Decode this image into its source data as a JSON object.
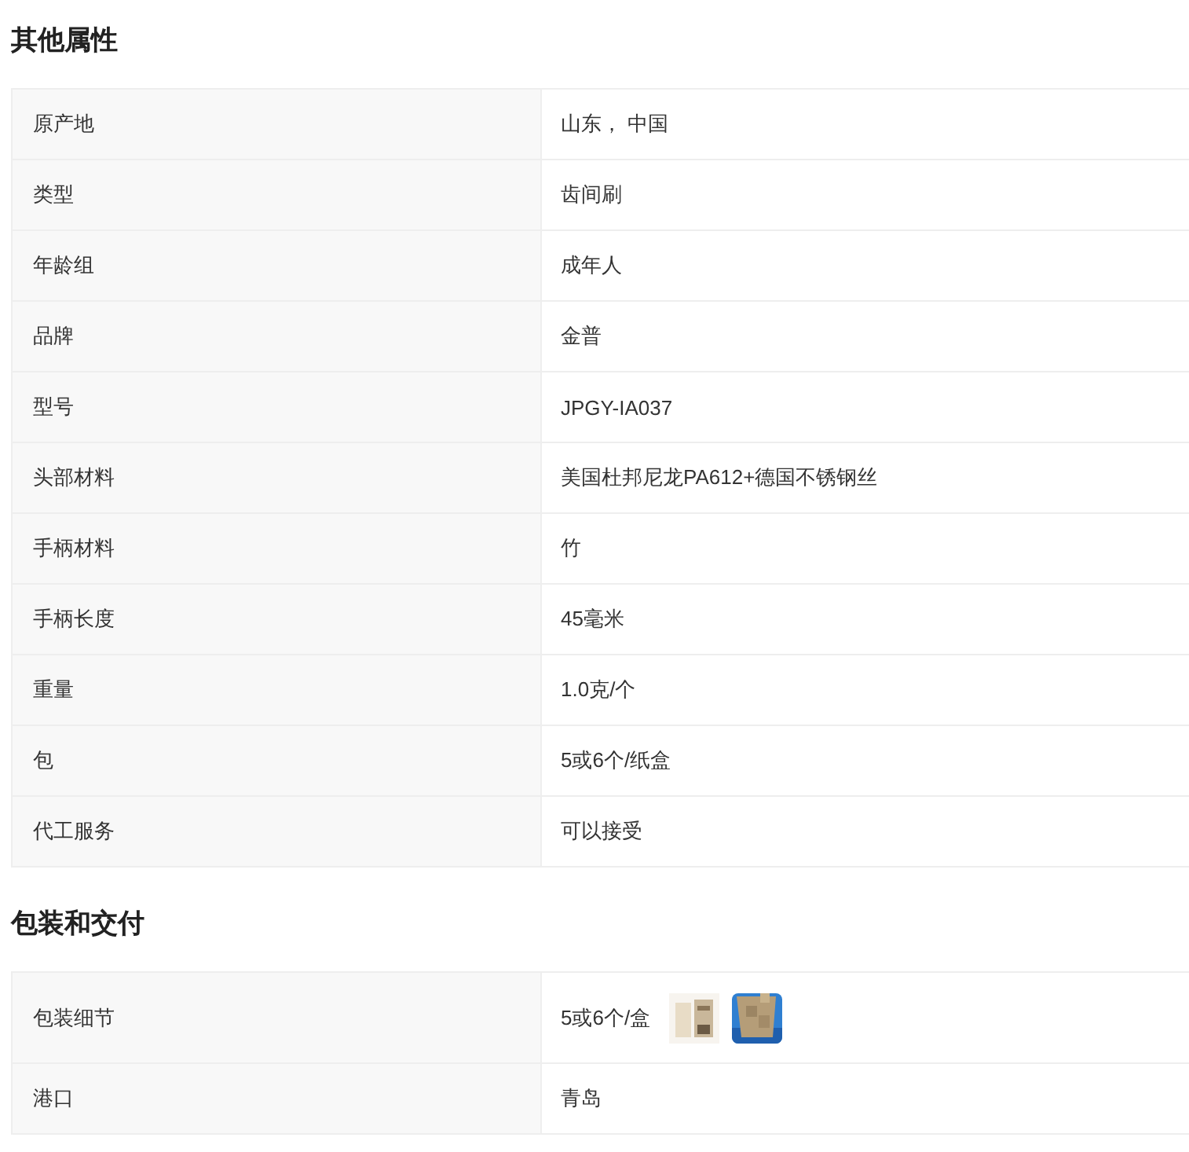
{
  "sections": [
    {
      "title": "其他属性",
      "rows": [
        {
          "label": "原产地",
          "value": "山东， 中国"
        },
        {
          "label": "类型",
          "value": "齿间刷"
        },
        {
          "label": "年龄组",
          "value": "成年人"
        },
        {
          "label": "品牌",
          "value": "金普"
        },
        {
          "label": "型号",
          "value": "JPGY-IA037"
        },
        {
          "label": "头部材料",
          "value": "美国杜邦尼龙PA612+德国不锈钢丝"
        },
        {
          "label": "手柄材料",
          "value": "竹"
        },
        {
          "label": "手柄长度",
          "value": "45毫米"
        },
        {
          "label": "重量",
          "value": "1.0克/个"
        },
        {
          "label": "包",
          "value": "5或6个/纸盒"
        },
        {
          "label": "代工服务",
          "value": "可以接受"
        }
      ]
    },
    {
      "title": "包装和交付",
      "rows": [
        {
          "label": "包装细节",
          "value": "5或6个/盒"
        },
        {
          "label": "港口",
          "value": "青岛"
        }
      ]
    }
  ]
}
